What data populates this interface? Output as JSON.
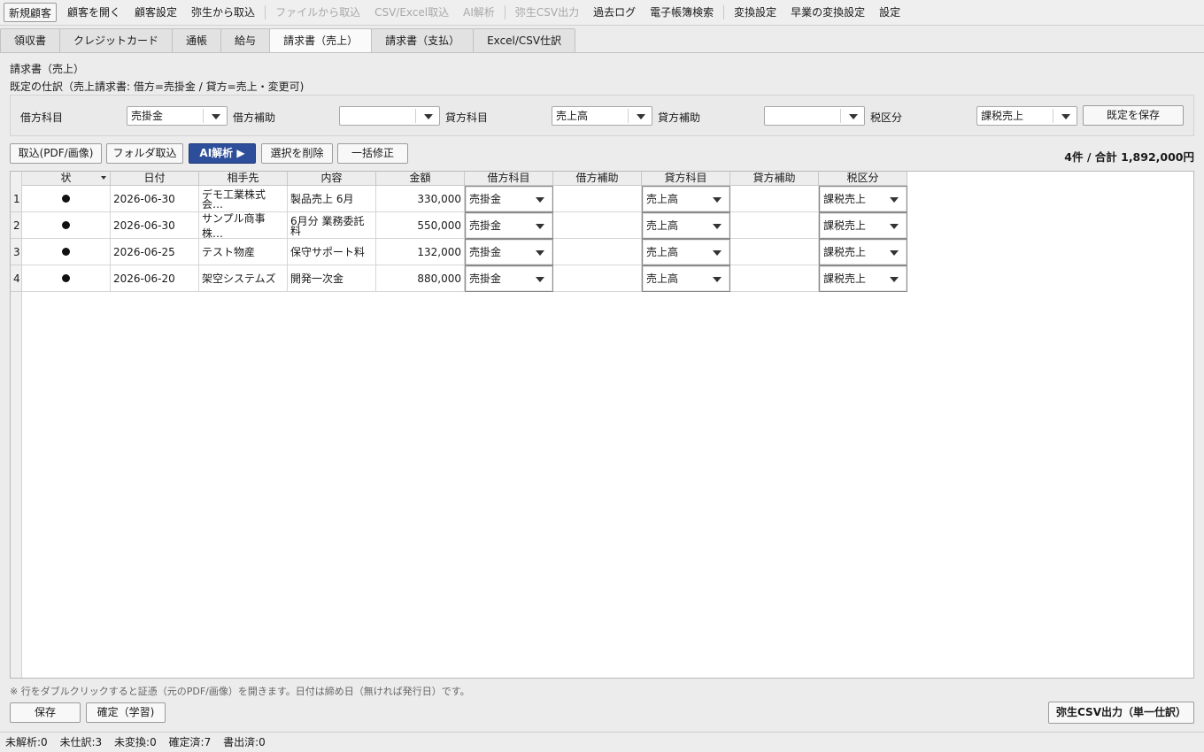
{
  "menu": {
    "items": [
      {
        "label": "新規顧客",
        "boxed": true,
        "disabled": false
      },
      {
        "label": "顧客を開く",
        "disabled": false
      },
      {
        "label": "顧客設定",
        "disabled": false
      },
      {
        "label": "弥生から取込",
        "disabled": false
      },
      {
        "label": "ファイルから取込",
        "disabled": true
      },
      {
        "label": "CSV/Excel取込",
        "disabled": true
      },
      {
        "label": "AI解析",
        "disabled": true
      },
      {
        "label": "弥生CSV出力",
        "disabled": true
      },
      {
        "label": "過去ログ",
        "disabled": false
      },
      {
        "label": "電子帳簿検索",
        "disabled": false
      },
      {
        "label": "変換設定",
        "disabled": false
      },
      {
        "label": "早業の変換設定",
        "disabled": false
      },
      {
        "label": "設定",
        "disabled": false
      }
    ]
  },
  "tabs": [
    "領収書",
    "クレジットカード",
    "通帳",
    "給与",
    "請求書（売上）",
    "請求書（支払）",
    "Excel/CSV仕訳"
  ],
  "active_tab": "請求書（売上）",
  "panel": {
    "title": "請求書（売上）",
    "subtitle": "既定の仕訳（売上請求書: 借方=売掛金 / 貸方=売上・変更可)"
  },
  "defaults": {
    "debit_label": "借方科目",
    "debit_value": "売掛金",
    "debit_sub_label": "借方補助",
    "debit_sub_value": "",
    "credit_label": "貸方科目",
    "credit_value": "売上高",
    "credit_sub_label": "貸方補助",
    "credit_sub_value": "",
    "tax_label": "税区分",
    "tax_value": "課税売上",
    "save_label": "既定を保存"
  },
  "toolbar": {
    "import_label": "取込(PDF/画像)",
    "folder_label": "フォルダ取込",
    "ai_label": "AI解析 ▶",
    "delete_label": "選択を削除",
    "bulk_label": "一括修正"
  },
  "summary": "4件 / 合計 1,892,000円",
  "table": {
    "columns": [
      "状",
      "日付",
      "相手先",
      "内容",
      "金額",
      "借方科目",
      "借方補助",
      "貸方科目",
      "貸方補助",
      "税区分"
    ],
    "rows": [
      {
        "num": "1",
        "date": "2026-06-30",
        "partner": "デモ工業株式会…",
        "content": "製品売上 6月",
        "amount": "330,000",
        "debit": "売掛金",
        "debit_sub": "",
        "credit": "売上高",
        "credit_sub": "",
        "tax": "課税売上"
      },
      {
        "num": "2",
        "date": "2026-06-30",
        "partner": "サンプル商事株…",
        "content": "6月分 業務委託料",
        "amount": "550,000",
        "debit": "売掛金",
        "debit_sub": "",
        "credit": "売上高",
        "credit_sub": "",
        "tax": "課税売上"
      },
      {
        "num": "3",
        "date": "2026-06-25",
        "partner": "テスト物産",
        "content": "保守サポート料",
        "amount": "132,000",
        "debit": "売掛金",
        "debit_sub": "",
        "credit": "売上高",
        "credit_sub": "",
        "tax": "課税売上"
      },
      {
        "num": "4",
        "date": "2026-06-20",
        "partner": "架空システムズ",
        "content": "開発一次金",
        "amount": "880,000",
        "debit": "売掛金",
        "debit_sub": "",
        "credit": "売上高",
        "credit_sub": "",
        "tax": "課税売上"
      }
    ]
  },
  "note": "※ 行をダブルクリックすると証憑（元のPDF/画像）を開きます。日付は締め日（無ければ発行日）です。",
  "bottom": {
    "save_label": "保存",
    "confirm_label": "確定（学習)",
    "export_label": "弥生CSV出力（単一仕訳）"
  },
  "status": [
    "未解析:0",
    "未仕訳:3",
    "未変換:0",
    "確定済:7",
    "書出済:0"
  ]
}
